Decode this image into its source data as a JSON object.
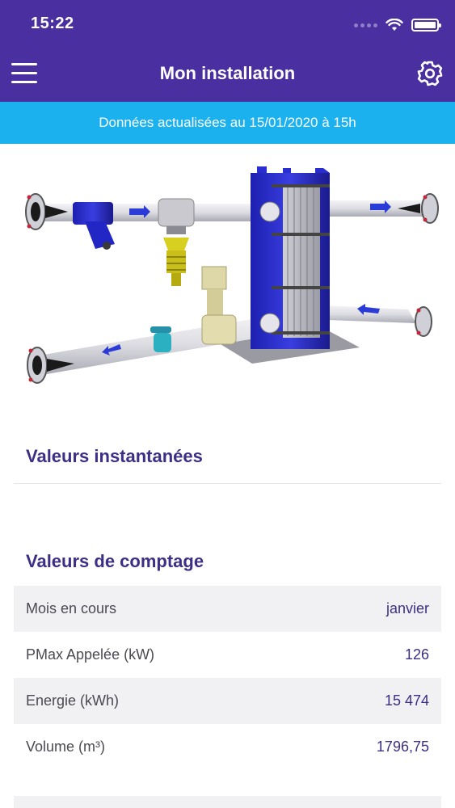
{
  "status_bar": {
    "time": "15:22"
  },
  "header": {
    "title": "Mon installation",
    "menu_icon": "hamburger-menu-icon",
    "settings_icon": "gear-icon"
  },
  "banner": {
    "text": "Données actualisées au 15/01/2020 à 15h"
  },
  "colors": {
    "header": "#4a2fa0",
    "banner": "#1bb1ee",
    "accent": "#3b2f86",
    "row_alt": "#f1f1f3"
  },
  "sections": {
    "instant": {
      "title": "Valeurs instantanées"
    },
    "metering": {
      "title": "Valeurs de comptage",
      "rows": [
        {
          "label": "Mois en cours",
          "value": "janvier"
        },
        {
          "label": "PMax Appelée (kW)",
          "value": "126"
        },
        {
          "label": "Energie (kWh)",
          "value": "15 474"
        },
        {
          "label": "Volume (m³)",
          "value": "1796,75"
        }
      ]
    }
  }
}
